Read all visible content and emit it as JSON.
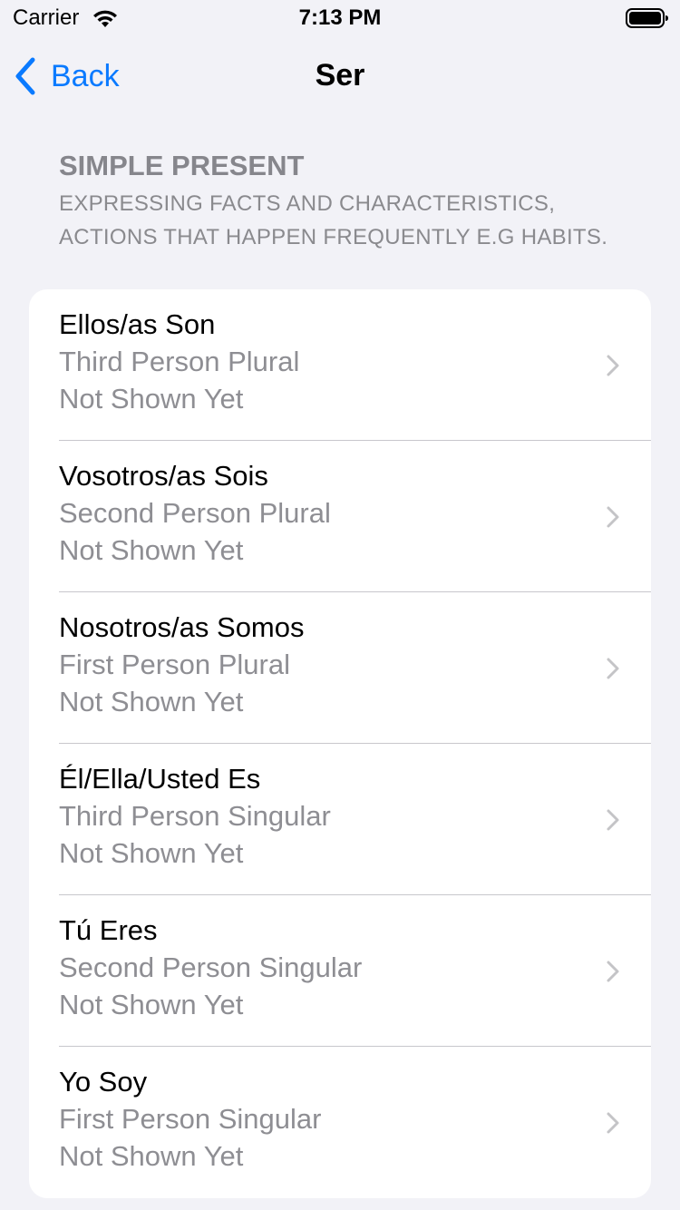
{
  "status_bar": {
    "carrier": "Carrier",
    "time": "7:13 PM",
    "wifi_icon": "wifi-icon",
    "battery_icon": "battery-icon"
  },
  "nav": {
    "back_label": "Back",
    "back_icon": "chevron-left-icon",
    "title": "Ser",
    "accent_color": "#0a7aff"
  },
  "section": {
    "title": "SIMPLE PRESENT",
    "subtitle": "EXPRESSING FACTS AND CHARACTERISTICS, ACTIONS THAT HAPPEN FREQUENTLY E.G HABITS."
  },
  "rows": [
    {
      "title": "Ellos/as Son",
      "person": "Third Person Plural",
      "status": "Not Shown Yet"
    },
    {
      "title": "Vosotros/as Sois",
      "person": "Second Person Plural",
      "status": "Not Shown Yet"
    },
    {
      "title": "Nosotros/as Somos",
      "person": "First Person Plural",
      "status": "Not Shown Yet"
    },
    {
      "title": "Él/Ella/Usted Es",
      "person": "Third Person Singular",
      "status": "Not Shown Yet"
    },
    {
      "title": "Tú Eres",
      "person": "Second Person Singular",
      "status": "Not Shown Yet"
    },
    {
      "title": "Yo Soy",
      "person": "First Person Singular",
      "status": "Not Shown Yet"
    }
  ],
  "row_icon": "chevron-right-icon"
}
